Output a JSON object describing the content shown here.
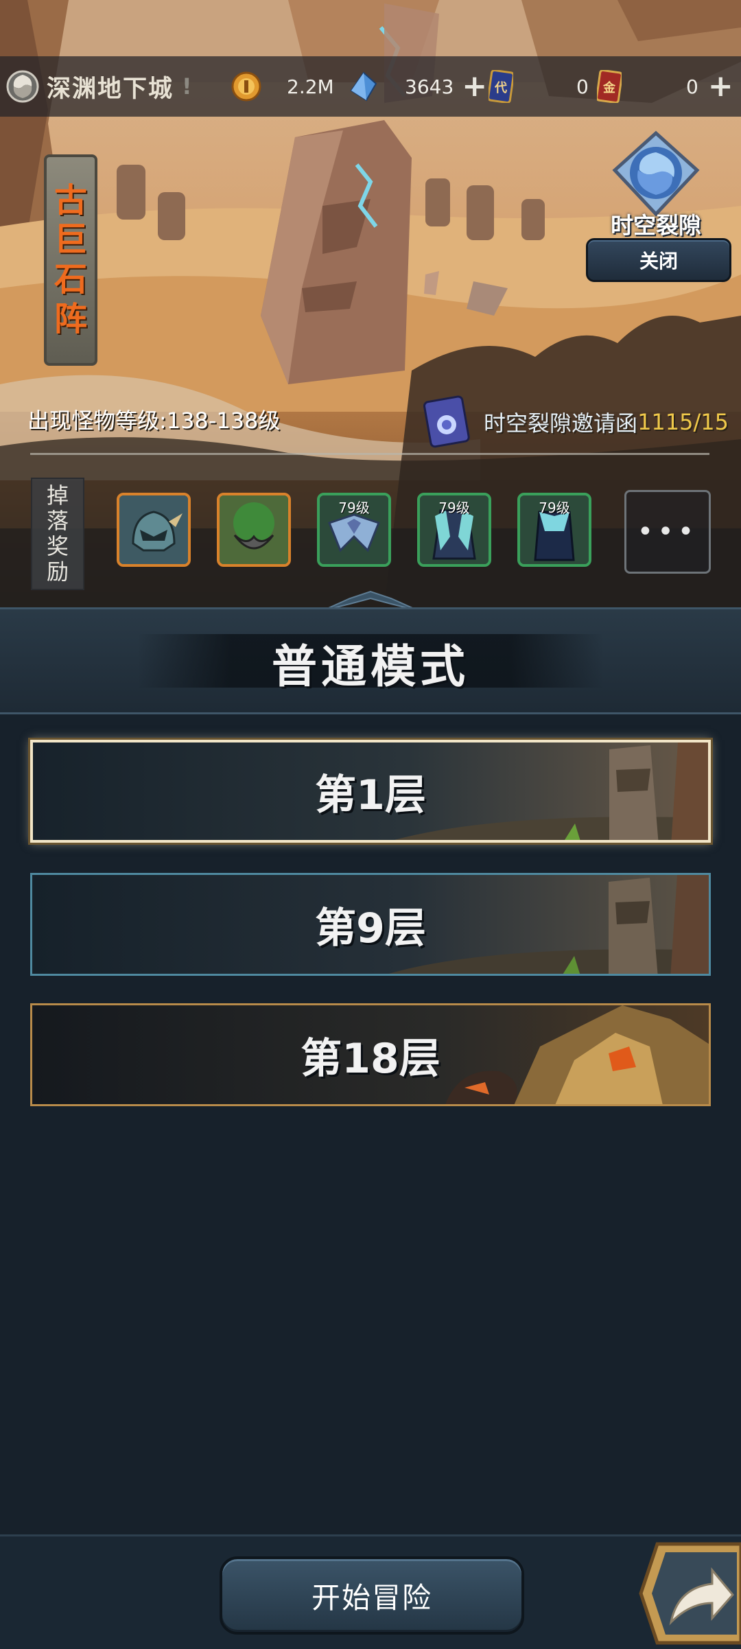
{
  "topbar": {
    "dungeon_name": "深渊地下城",
    "alert_mark": "!",
    "gold": "2.2M",
    "crystal": "3643",
    "ticket_a": "0",
    "ticket_a_glyph": "代",
    "ticket_b": "0",
    "ticket_b_glyph": "金",
    "plus": "+"
  },
  "stage": {
    "title_chars": [
      "古",
      "巨",
      "石",
      "阵"
    ],
    "monster_level": "出现怪物等级:138-138级",
    "invite_label": "时空裂隙邀请函",
    "invite_count": "1115/15"
  },
  "rift": {
    "label": "时空裂隙",
    "close_label": "关闭"
  },
  "drops": {
    "label_chars": [
      "掉",
      "落",
      "奖",
      "励"
    ],
    "items": [
      {
        "name": "helmet-dragon",
        "level": ""
      },
      {
        "name": "leaf-stone",
        "level": ""
      },
      {
        "name": "ice-shoulder",
        "level": "79级"
      },
      {
        "name": "ice-robe",
        "level": "79级"
      },
      {
        "name": "ice-cloak",
        "level": "79级"
      }
    ],
    "more": "•••"
  },
  "mode": {
    "title": "普通模式"
  },
  "floors": [
    {
      "label": "第1层",
      "selected": true
    },
    {
      "label": "第9层",
      "selected": false
    },
    {
      "label": "第18层",
      "selected": false
    }
  ],
  "actions": {
    "start": "开始冒险"
  },
  "colors": {
    "accent_gold": "#f0c94a",
    "panel_dark": "#17212b",
    "orange_title": "#ef6b1e"
  }
}
